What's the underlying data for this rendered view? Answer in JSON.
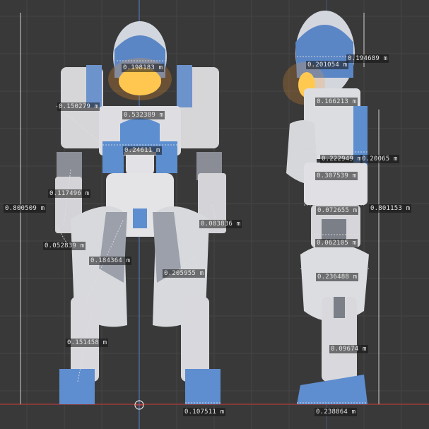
{
  "viewport": {
    "colors": {
      "background": "#393939",
      "grid": "#454545",
      "x_axis": "#9c3a3a",
      "y_axis": "#4c6a9a",
      "robot_body": "#d9d9dc",
      "robot_blue": "#5d8fd0",
      "visor_glow": "#ffd24a"
    }
  },
  "front_view": {
    "measurements": [
      "0.198183 m",
      "0.150279 m",
      "0.532389 m",
      "0.24611 m",
      "0.117496 m",
      "0.800509 m",
      "0.052839 m",
      "0.083836 m",
      "0.184364 m",
      "0.205955 m",
      "0.151458 m",
      "0.107511 m"
    ]
  },
  "side_view": {
    "measurements": [
      "0.201054 m",
      "0.194689 m",
      "0.166213 m",
      "0.222949 m",
      "0.20065 m",
      "0.307539 m",
      "0.801153 m",
      "0.072655 m",
      "0.062105 m",
      "0.236488 m",
      "0.09674 m",
      "0.238864 m"
    ]
  }
}
